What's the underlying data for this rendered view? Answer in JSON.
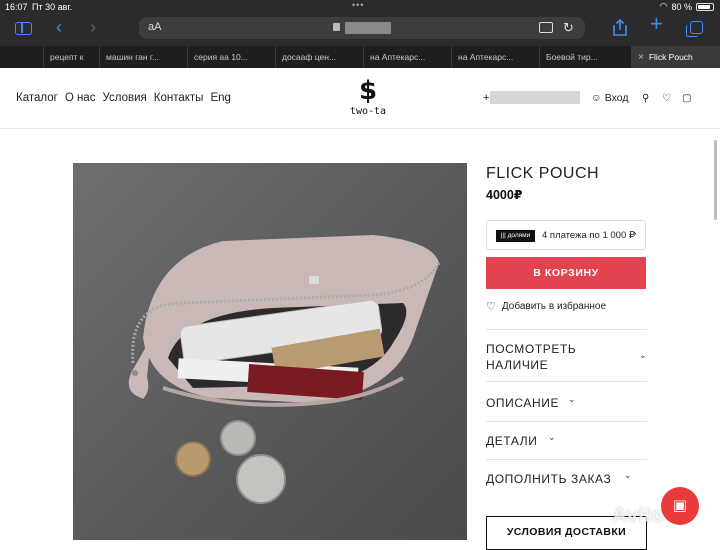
{
  "status": {
    "time": "16:07",
    "date": "Пт 30 авг.",
    "battery": "80 %"
  },
  "browser": {
    "address_text": "aA",
    "tabs": [
      {
        "title": "",
        "favicon": "fire",
        "favicon_color": "#f29a2e"
      },
      {
        "title": "рецепт к",
        "favicon": "G",
        "favicon_color": "#4285f4"
      },
      {
        "title": "машин ган г...",
        "favicon": "G",
        "favicon_color": "#5f6368"
      },
      {
        "title": "серия аа 10...",
        "favicon": "G",
        "favicon_color": "#4285f4"
      },
      {
        "title": "досааф цен...",
        "favicon": "G",
        "favicon_color": "#4285f4"
      },
      {
        "title": "на Аптекарс...",
        "favicon": "A",
        "favicon_color": "#d8504d"
      },
      {
        "title": "на Аптекарс...",
        "favicon": "A",
        "favicon_color": "#d8504d"
      },
      {
        "title": "Боевой тир...",
        "favicon": "B",
        "favicon_color": "#2a9bd8"
      },
      {
        "title": "Flick Pouch",
        "favicon": "x",
        "favicon_color": "#888888",
        "active": true
      }
    ]
  },
  "site": {
    "nav": [
      "Каталог",
      "О нас",
      "Условия",
      "Контакты",
      "Eng"
    ],
    "logo_mark": "$",
    "logo_word": "two-ta",
    "phone_prefix": "+",
    "login": "Вход"
  },
  "product": {
    "title": "FLICK POUCH",
    "price": "4000₽",
    "dolyami_badge": "||| долями",
    "dolyami_text": "4 платежа по 1 000 ₽",
    "cart_button": "В КОРЗИНУ",
    "favorite": "Добавить в избранное",
    "accordion": [
      {
        "label_line1": "ПОСМОТРЕТЬ",
        "label_line2": "НАЛИЧИЕ"
      },
      {
        "label_line1": "ОПИСАНИЕ",
        "label_line2": ""
      },
      {
        "label_line1": "ДЕТАЛИ",
        "label_line2": ""
      },
      {
        "label_line1": "ДОПОЛНИТЬ ЗАКАЗ",
        "label_line2": ""
      }
    ],
    "delivery_button": "УСЛОВИЯ ДОСТАВКИ"
  },
  "watermark": "Avito",
  "colors": {
    "accent_red": "#e2434f",
    "browser_blue": "#3b8cf5"
  }
}
